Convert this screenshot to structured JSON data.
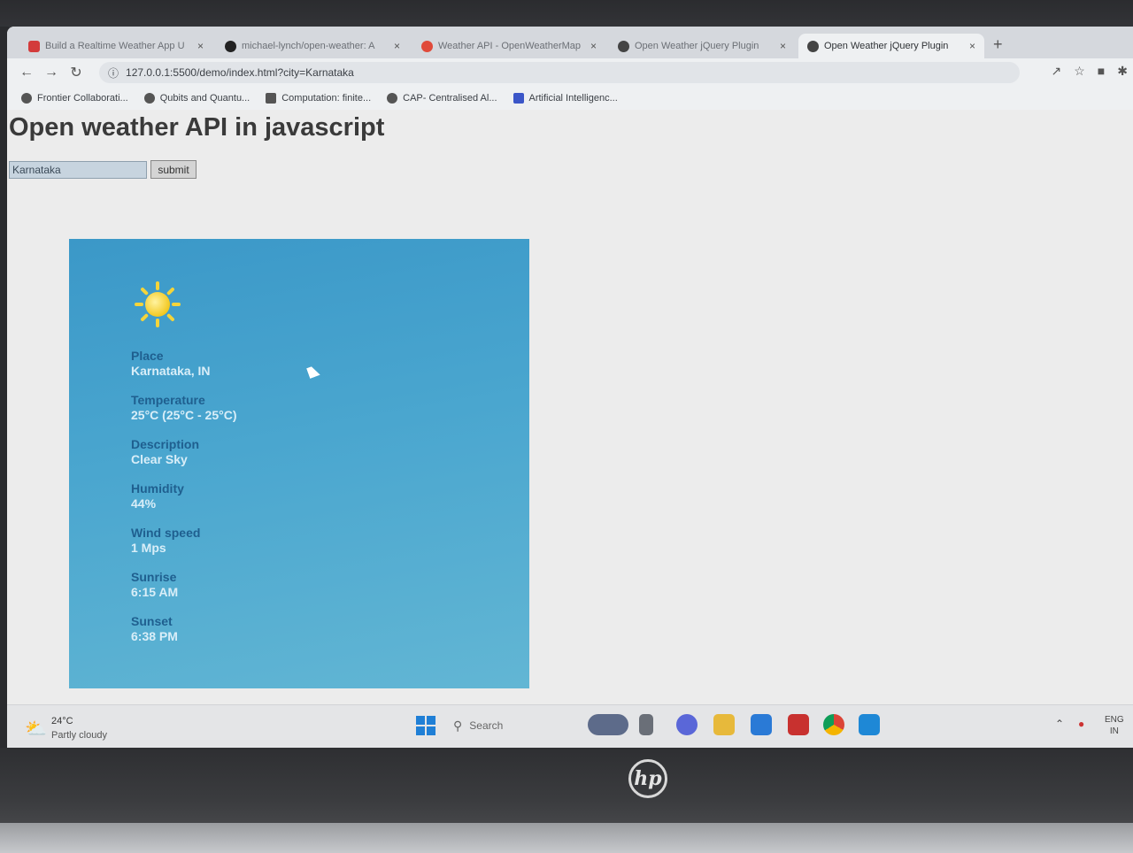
{
  "browser": {
    "tabs": [
      {
        "title": "Build a Realtime Weather App U",
        "color": "#d33b3b",
        "active": false
      },
      {
        "title": "michael-lynch/open-weather: A",
        "color": "#222222",
        "active": false
      },
      {
        "title": "Weather API - OpenWeatherMap",
        "color": "#e04a3a",
        "active": false
      },
      {
        "title": "Open Weather jQuery Plugin",
        "color": "#444444",
        "active": false
      },
      {
        "title": "Open Weather jQuery Plugin",
        "color": "#444444",
        "active": true
      }
    ],
    "new_tab": "+",
    "close_symbol": "×",
    "url": "127.0.0.1:5500/demo/index.html?city=Karnataka",
    "bookmarks": [
      {
        "label": "Frontier Collaborati..."
      },
      {
        "label": "Qubits and Quantu..."
      },
      {
        "label": "Computation: finite..."
      },
      {
        "label": "CAP- Centralised Al..."
      },
      {
        "label": "Artificial Intelligenc..."
      }
    ]
  },
  "page": {
    "heading": "Open weather API in javascript",
    "city_input_value": "Karnataka",
    "submit_label": "submit",
    "weather": {
      "icon": "sun-icon",
      "fields": [
        {
          "label": "Place",
          "value": "Karnataka, IN"
        },
        {
          "label": "Temperature",
          "value": "25°C (25°C - 25°C)"
        },
        {
          "label": "Description",
          "value": "Clear Sky"
        },
        {
          "label": "Humidity",
          "value": "44%"
        },
        {
          "label": "Wind speed",
          "value": "1 Mps"
        },
        {
          "label": "Sunrise",
          "value": "6:15 AM"
        },
        {
          "label": "Sunset",
          "value": "6:38 PM"
        }
      ]
    }
  },
  "taskbar": {
    "weather_temp": "24°C",
    "weather_desc": "Partly cloudy",
    "search_placeholder": "Search",
    "lang_line1": "ENG",
    "lang_line2": "IN"
  },
  "device": {
    "brand": "hp"
  }
}
